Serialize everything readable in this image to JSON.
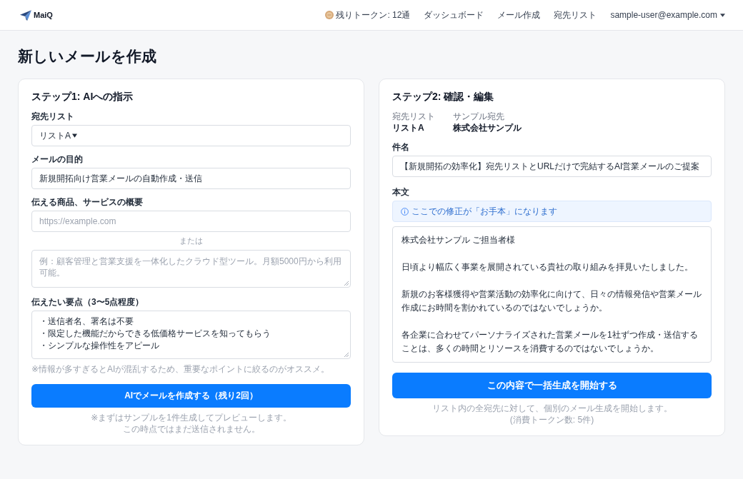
{
  "header": {
    "logo": "MaiQ",
    "tokens": "残りトークン: 12通",
    "nav": [
      "ダッシュボード",
      "メール作成",
      "宛先リスト"
    ],
    "user": "sample-user@example.com"
  },
  "page_title": "新しいメールを作成",
  "step1": {
    "title": "ステップ1: AIへの指示",
    "recipient_list": {
      "label": "宛先リスト",
      "value": "リストA"
    },
    "purpose": {
      "label": "メールの目的",
      "value": "新規開拓向け営業メールの自動作成・送信"
    },
    "product": {
      "label": "伝える商品、サービスの概要",
      "url_field": {
        "placeholder": "https://example.com"
      },
      "separator": "または",
      "description_field": {
        "placeholder": "例：顧客管理と営業支援を一体化したクラウド型ツール。月額5000円から利用可能。"
      }
    },
    "key_points": {
      "label": "伝えたい要点（3〜5点程度）",
      "lines": [
        "・送信者名、署名は不要",
        "・限定した機能だからできる低価格サービスを知ってもらう",
        "・シンプルな操作性をアピール"
      ]
    },
    "hint": "※情報が多すぎるとAIが混乱するため、重要なポイントに絞るのがオススメ。",
    "button": "AIでメールを作成する（残り2回）",
    "notes": [
      "※まずはサンプルを1件生成してプレビューします。",
      "この時点ではまだ送信されません。"
    ]
  },
  "step2": {
    "title": "ステップ2: 確認・編集",
    "meta": [
      {
        "label": "宛先リスト",
        "value": "リストA"
      },
      {
        "label": "サンプル宛先",
        "value": "株式会社サンプル"
      }
    ],
    "subject": {
      "label": "件名",
      "value": "【新規開拓の効率化】宛先リストとURLだけで完結するAI営業メールのご提案"
    },
    "body": {
      "label": "本文",
      "notice": "ここでの修正が「お手本」になります",
      "paragraphs": [
        "株式会社サンプル ご担当者様",
        "日頃より幅広く事業を展開されている貴社の取り組みを拝見いたしました。",
        "新規のお客様獲得や営業活動の効率化に向けて、日々の情報発信や営業メール作成にお時間を割かれているのではないでしょうか。",
        "各企業に合わせてパーソナライズされた営業メールを1社ずつ作成・送信することは、多くの時間とリソースを消費するのではないでしょうか。"
      ]
    },
    "button": "この内容で一括生成を開始する",
    "notes": [
      "リスト内の全宛先に対して、個別のメール生成を開始します。",
      "(消費トークン数: 5件)"
    ]
  }
}
